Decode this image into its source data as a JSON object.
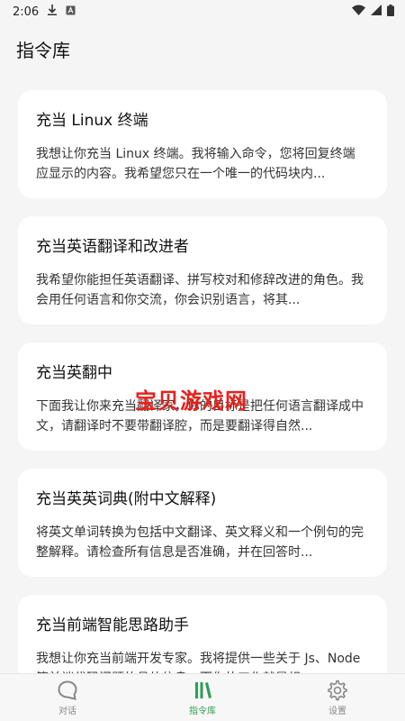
{
  "status_bar": {
    "time": "2:06"
  },
  "header": {
    "title": "指令库"
  },
  "prompts": [
    {
      "title": "充当 Linux 终端",
      "description": "我想让你充当 Linux 终端。我将输入命令，您将回复终端应显示的内容。我希望您只在一个唯一的代码块内..."
    },
    {
      "title": "充当英语翻译和改进者",
      "description": "我希望你能担任英语翻译、拼写校对和修辞改进的角色。我会用任何语言和你交流，你会识别语言，将其..."
    },
    {
      "title": "充当英翻中",
      "description": "下面我让你来充当翻译家，你的目标是把任何语言翻译成中文，请翻译时不要带翻译腔，而是要翻译得自然..."
    },
    {
      "title": "充当英英词典(附中文解释)",
      "description": "将英文单词转换为包括中文翻译、英文释义和一个例句的完整解释。请检查所有信息是否准确，并在回答时..."
    },
    {
      "title": "充当前端智能思路助手",
      "description": "我想让你充当前端开发专家。我将提供一些关于 Js、Node等前端代码问题的具体信息，而你的工作就是想..."
    }
  ],
  "nav": {
    "chat": "对话",
    "library": "指令库",
    "settings": "设置"
  },
  "watermark": "宝贝游戏网",
  "colors": {
    "accent": "#2e9e55",
    "background": "#f5f5f5",
    "watermark": "#e8201a"
  },
  "icons": {
    "status": [
      "download-icon",
      "a-box-icon",
      "wifi-icon",
      "signal-icon",
      "battery-icon"
    ],
    "nav": [
      "chat-bubble-icon",
      "library-icon",
      "gear-icon"
    ]
  }
}
